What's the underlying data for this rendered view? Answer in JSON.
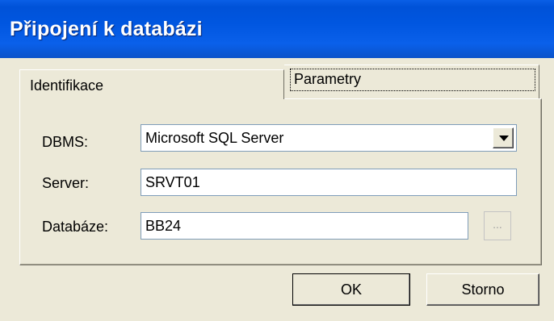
{
  "window": {
    "title": "Připojení k databázi"
  },
  "tabs": [
    {
      "label": "Identifikace"
    },
    {
      "label": "Parametry"
    }
  ],
  "form": {
    "dbms_label": "DBMS:",
    "dbms_value": "Microsoft SQL Server",
    "server_label": "Server:",
    "server_value": "SRVT01",
    "database_label": "Databáze:",
    "database_value": "BB24",
    "browse_label": "..."
  },
  "buttons": {
    "ok_label": "OK",
    "cancel_label": "Storno"
  },
  "colors": {
    "titlebar": "#0054e3",
    "dialog_bg": "#ece9d8"
  }
}
